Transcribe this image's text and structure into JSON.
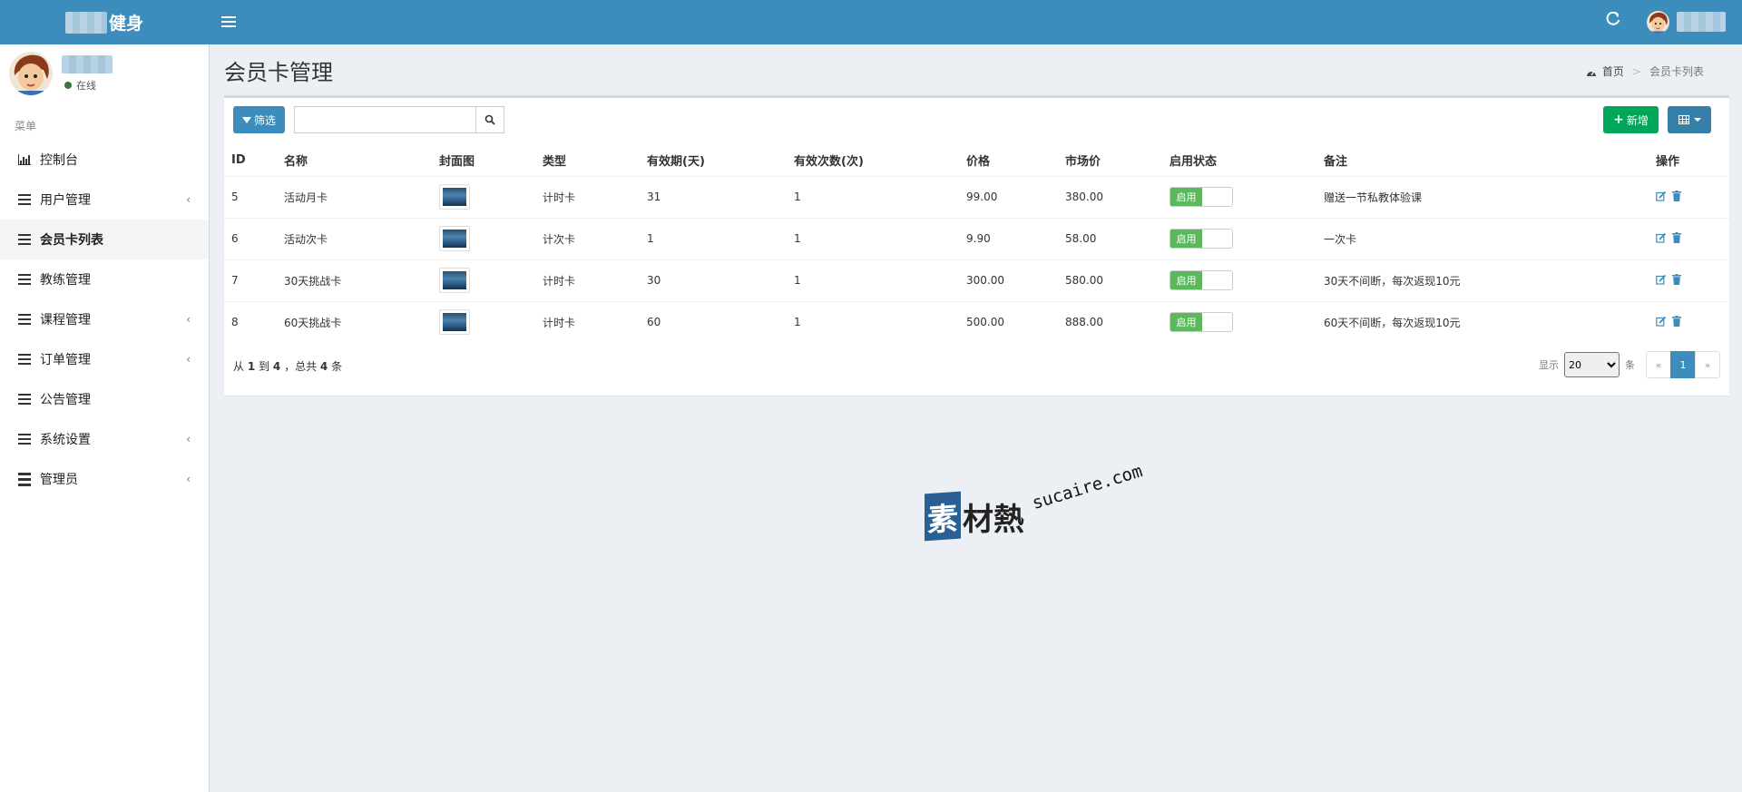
{
  "header": {
    "brand_text": "健身",
    "refresh_icon": "refresh-icon",
    "menu_icon": "bars-icon"
  },
  "sidebar": {
    "status": "在线",
    "menu_header": "菜单",
    "items": [
      {
        "label": "控制台",
        "icon": "bar-chart-icon"
      },
      {
        "label": "用户管理",
        "icon": "bars-icon",
        "has_children": true
      },
      {
        "label": "会员卡列表",
        "icon": "bars-icon",
        "active": true
      },
      {
        "label": "教练管理",
        "icon": "bars-icon"
      },
      {
        "label": "课程管理",
        "icon": "bars-icon",
        "has_children": true
      },
      {
        "label": "订单管理",
        "icon": "bars-icon",
        "has_children": true
      },
      {
        "label": "公告管理",
        "icon": "bars-icon"
      },
      {
        "label": "系统设置",
        "icon": "bars-icon",
        "has_children": true
      },
      {
        "label": "管理员",
        "icon": "list-icon",
        "has_children": true
      }
    ],
    "arrow": "‹"
  },
  "page": {
    "title": "会员卡管理",
    "breadcrumb": {
      "home": "首页",
      "sep": ">",
      "current": "会员卡列表"
    }
  },
  "toolbar": {
    "filter_label": "筛选",
    "search_value": "",
    "add_label": "新增"
  },
  "table": {
    "columns": [
      "ID",
      "名称",
      "封面图",
      "类型",
      "有效期(天)",
      "有效次数(次)",
      "价格",
      "市场价",
      "启用状态",
      "备注",
      "操作"
    ],
    "switch_label": "启用",
    "rows": [
      {
        "id": "5",
        "name": "活动月卡",
        "type": "计时卡",
        "days": "31",
        "times": "1",
        "price": "99.00",
        "market": "380.00",
        "note": "赠送一节私教体验课"
      },
      {
        "id": "6",
        "name": "活动次卡",
        "type": "计次卡",
        "days": "1",
        "times": "1",
        "price": "9.90",
        "market": "58.00",
        "note": "一次卡"
      },
      {
        "id": "7",
        "name": "30天挑战卡",
        "type": "计时卡",
        "days": "30",
        "times": "1",
        "price": "300.00",
        "market": "580.00",
        "note": "30天不间断，每次返现10元"
      },
      {
        "id": "8",
        "name": "60天挑战卡",
        "type": "计时卡",
        "days": "60",
        "times": "1",
        "price": "500.00",
        "market": "888.00",
        "note": "60天不间断，每次返现10元"
      }
    ]
  },
  "footer": {
    "from_label": "从",
    "from": "1",
    "to_label": "到",
    "to": "4",
    "total_label": "，总共",
    "total": "4",
    "unit": "条",
    "show_label": "显示",
    "page_size": "20",
    "per_unit": "条",
    "prev": "«",
    "current_page": "1",
    "next": "»"
  },
  "watermark": {
    "logo_char": "素",
    "cn_text": "材熱",
    "en_text": "sucaire.com"
  }
}
